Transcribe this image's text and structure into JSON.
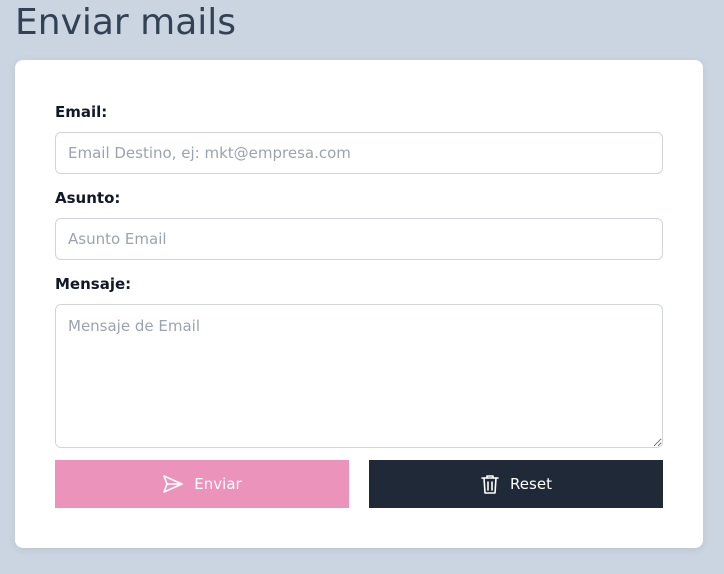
{
  "page": {
    "title": "Enviar mails"
  },
  "form": {
    "email": {
      "label": "Email:",
      "placeholder": "Email Destino, ej: mkt@empresa.com",
      "value": ""
    },
    "subject": {
      "label": "Asunto:",
      "placeholder": "Asunto Email",
      "value": ""
    },
    "message": {
      "label": "Mensaje:",
      "placeholder": "Mensaje de Email",
      "value": ""
    }
  },
  "buttons": {
    "send": {
      "label": "Enviar",
      "icon": "send-icon",
      "color": "#ec93bb"
    },
    "reset": {
      "label": "Reset",
      "icon": "trash-icon",
      "color": "#1f2937"
    }
  },
  "colors": {
    "background": "#cbd5e1",
    "card": "#ffffff"
  }
}
